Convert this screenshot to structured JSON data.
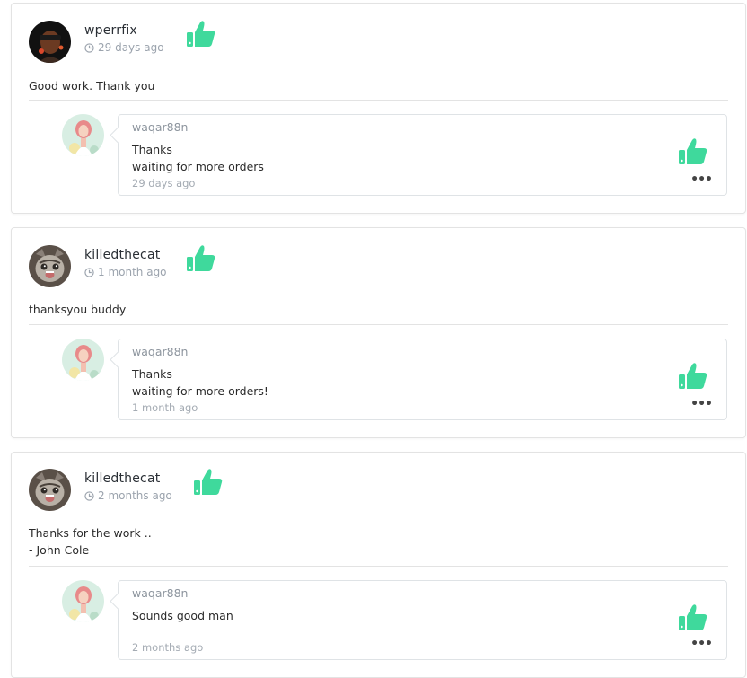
{
  "accent_color": "#3fd99c",
  "reviews": [
    {
      "username": "wperrfix",
      "time": "29 days ago",
      "text": [
        "Good work. Thank you"
      ],
      "avatar_icon": "user-avatar-dark",
      "reply": {
        "username": "waqar88n",
        "text": [
          "Thanks",
          "waiting for more orders"
        ],
        "time": "29 days ago",
        "avatar_icon": "seller-avatar"
      }
    },
    {
      "username": "killedthecat",
      "time": "1 month ago",
      "text": [
        "thanksyou buddy"
      ],
      "avatar_icon": "cat-avatar",
      "reply": {
        "username": "waqar88n",
        "text": [
          "Thanks",
          "waiting for more orders!"
        ],
        "time": "1 month ago",
        "avatar_icon": "seller-avatar"
      }
    },
    {
      "username": "killedthecat",
      "time": "2 months ago",
      "text": [
        "Thanks for the work ..",
        "- John Cole"
      ],
      "avatar_icon": "cat-avatar",
      "reply": {
        "username": "waqar88n",
        "text": [
          "Sounds good man"
        ],
        "time": "2 months ago",
        "avatar_icon": "seller-avatar"
      }
    }
  ],
  "icons": {
    "like": "thumbs-up-icon",
    "clock": "clock-icon",
    "more": "more-dots-icon"
  }
}
